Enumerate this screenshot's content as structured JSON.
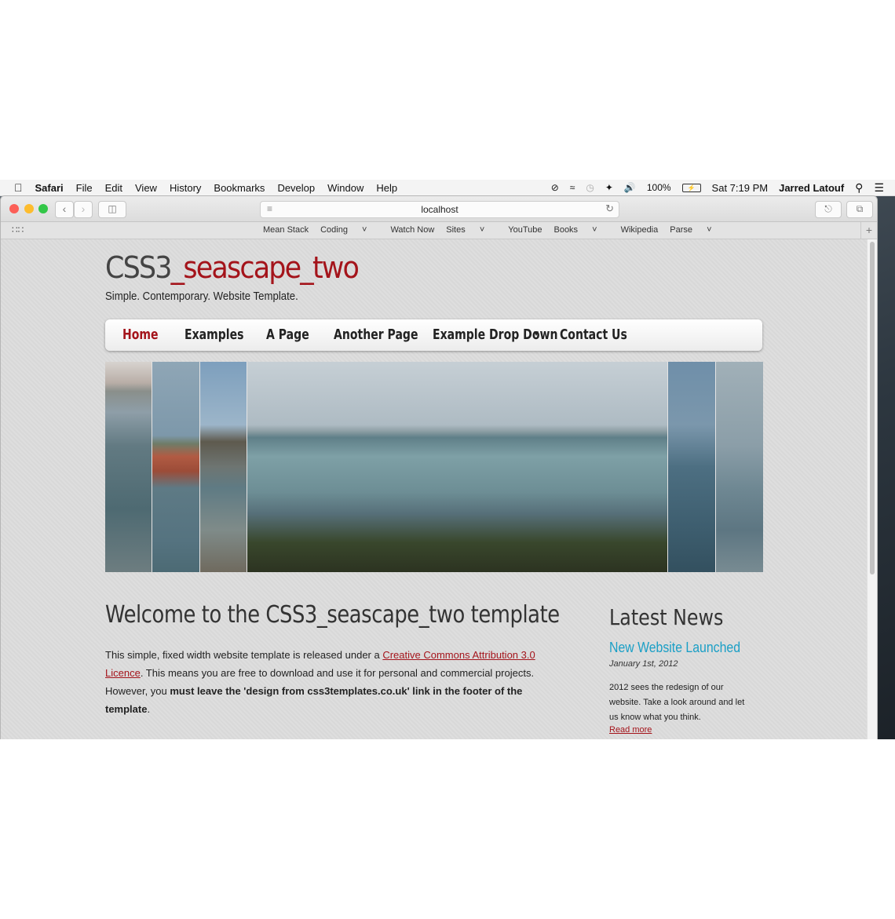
{
  "menubar": {
    "app": "Safari",
    "items": [
      "File",
      "Edit",
      "View",
      "History",
      "Bookmarks",
      "Develop",
      "Window",
      "Help"
    ],
    "battery": "100%",
    "clock": "Sat 7:19 PM",
    "user": "Jarred Latouf"
  },
  "browser": {
    "url": "localhost",
    "favorites": [
      "Mean Stack",
      "Coding",
      "Watch Now",
      "Sites",
      "YouTube",
      "Books",
      "Wikipedia",
      "Parse"
    ],
    "favorites_dropdowns": [
      "Coding",
      "Sites",
      "Books",
      "Parse"
    ]
  },
  "site": {
    "title_main": "CSS3",
    "title_accent": "_seascape_two",
    "slogan": "Simple. Contemporary. Website Template.",
    "nav": [
      "Home",
      "Examples",
      "A Page",
      "Another Page",
      "Example Drop Down",
      "Contact Us"
    ],
    "nav_active": "Home"
  },
  "content": {
    "heading": "Welcome to the CSS3_seascape_two template",
    "p1": "This simple, fixed width website template is released under a ",
    "link": "Creative Commons Attribution 3.0 Licence",
    "p2": ". This means you are free to download and use it for personal and commercial projects. However, you ",
    "bold": "must leave the 'design from css3templates.co.uk' link in the footer of the template",
    "p3": "."
  },
  "sidebar": {
    "heading": "Latest News",
    "news_title": "New Website Launched",
    "news_date": "January 1st, 2012",
    "news_body": "2012 sees the redesign of our website. Take a look around and let us know what you think.",
    "read_more": "Read more"
  },
  "colors": {
    "accent": "#a4141b",
    "news_link": "#1a9fc6"
  }
}
